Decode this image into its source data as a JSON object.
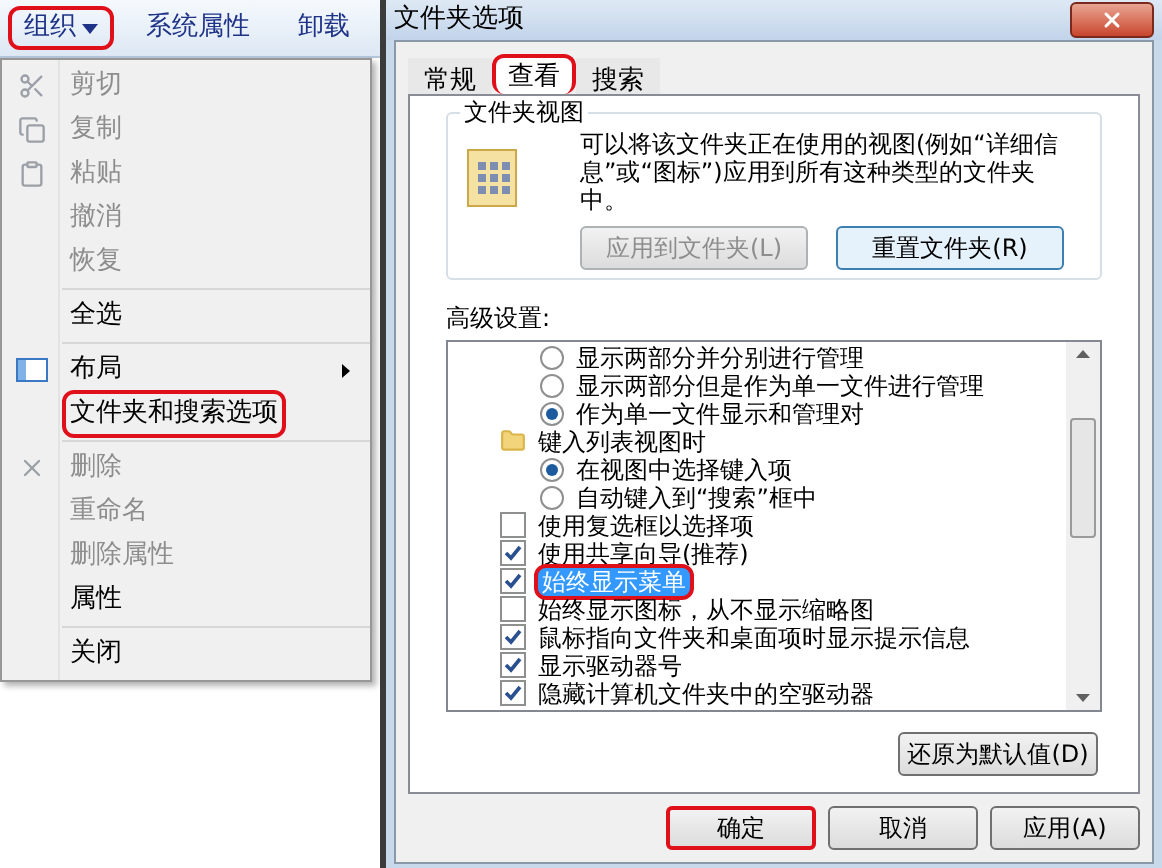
{
  "toolbar": {
    "items": [
      {
        "label": "组织",
        "dropdown": true,
        "highlighted": true
      },
      {
        "label": "系统属性",
        "dropdown": false,
        "highlighted": false
      },
      {
        "label": "卸载",
        "dropdown": false,
        "highlighted": false
      }
    ]
  },
  "menu": {
    "sections": [
      [
        {
          "label": "剪切",
          "disabled": true,
          "highlighted": false,
          "submenu": false
        },
        {
          "label": "复制",
          "disabled": true,
          "highlighted": false,
          "submenu": false
        },
        {
          "label": "粘贴",
          "disabled": true,
          "highlighted": false,
          "submenu": false
        },
        {
          "label": "撤消",
          "disabled": true,
          "highlighted": false,
          "submenu": false
        },
        {
          "label": "恢复",
          "disabled": true,
          "highlighted": false,
          "submenu": false
        }
      ],
      [
        {
          "label": "全选",
          "disabled": false,
          "highlighted": false,
          "submenu": false
        }
      ],
      [
        {
          "label": "布局",
          "disabled": false,
          "highlighted": false,
          "submenu": true
        },
        {
          "label": "文件夹和搜索选项",
          "disabled": false,
          "highlighted": true,
          "submenu": false
        }
      ],
      [
        {
          "label": "删除",
          "disabled": true,
          "highlighted": false,
          "submenu": false
        },
        {
          "label": "重命名",
          "disabled": true,
          "highlighted": false,
          "submenu": false
        },
        {
          "label": "删除属性",
          "disabled": true,
          "highlighted": false,
          "submenu": false
        },
        {
          "label": "属性",
          "disabled": false,
          "highlighted": false,
          "submenu": false
        }
      ],
      [
        {
          "label": "关闭",
          "disabled": false,
          "highlighted": false,
          "submenu": false
        }
      ]
    ]
  },
  "dialog": {
    "title": "文件夹选项",
    "tabs": [
      {
        "label": "常规",
        "selected": false,
        "highlighted": false
      },
      {
        "label": "查看",
        "selected": true,
        "highlighted": true
      },
      {
        "label": "搜索",
        "selected": false,
        "highlighted": false
      }
    ],
    "folder_views": {
      "title": "文件夹视图",
      "description": "可以将该文件夹正在使用的视图(例如“详细信息”或“图标”)应用到所有这种类型的文件夹中。",
      "buttons": [
        {
          "label": "应用到文件夹(L)",
          "disabled": true,
          "focused": false
        },
        {
          "label": "重置文件夹(R)",
          "disabled": false,
          "focused": true
        }
      ]
    },
    "advanced_label": "高级设置:",
    "settings": [
      {
        "kind": "radio",
        "label": "显示两部分并分别进行管理",
        "checked": false,
        "selected": false,
        "highlighted": false
      },
      {
        "kind": "radio",
        "label": "显示两部分但是作为单一文件进行管理",
        "checked": false,
        "selected": false,
        "highlighted": false
      },
      {
        "kind": "radio",
        "label": "作为单一文件显示和管理对",
        "checked": true,
        "selected": false,
        "highlighted": false
      },
      {
        "kind": "folder",
        "label": "键入列表视图时",
        "selected": false,
        "highlighted": false,
        "children": [
          {
            "kind": "radio",
            "label": "在视图中选择键入项",
            "checked": true,
            "selected": false,
            "highlighted": false
          },
          {
            "kind": "radio",
            "label": "自动键入到“搜索”框中",
            "checked": false,
            "selected": false,
            "highlighted": false
          }
        ]
      },
      {
        "kind": "checkbox",
        "label": "使用复选框以选择项",
        "checked": false,
        "selected": false,
        "highlighted": false
      },
      {
        "kind": "checkbox",
        "label": "使用共享向导(推荐)",
        "checked": true,
        "selected": false,
        "highlighted": false
      },
      {
        "kind": "checkbox",
        "label": "始终显示菜单",
        "checked": true,
        "selected": true,
        "highlighted": true
      },
      {
        "kind": "checkbox",
        "label": "始终显示图标，从不显示缩略图",
        "checked": false,
        "selected": false,
        "highlighted": false
      },
      {
        "kind": "checkbox",
        "label": "鼠标指向文件夹和桌面项时显示提示信息",
        "checked": true,
        "selected": false,
        "highlighted": false
      },
      {
        "kind": "checkbox",
        "label": "显示驱动器号",
        "checked": true,
        "selected": false,
        "highlighted": false
      },
      {
        "kind": "checkbox",
        "label": "隐藏计算机文件夹中的空驱动器",
        "checked": true,
        "selected": false,
        "highlighted": false
      }
    ],
    "restore_button": "还原为默认值(D)",
    "buttons": [
      {
        "label": "确定",
        "highlighted": true
      },
      {
        "label": "取消",
        "highlighted": false
      },
      {
        "label": "应用(A)",
        "highlighted": false
      }
    ]
  }
}
